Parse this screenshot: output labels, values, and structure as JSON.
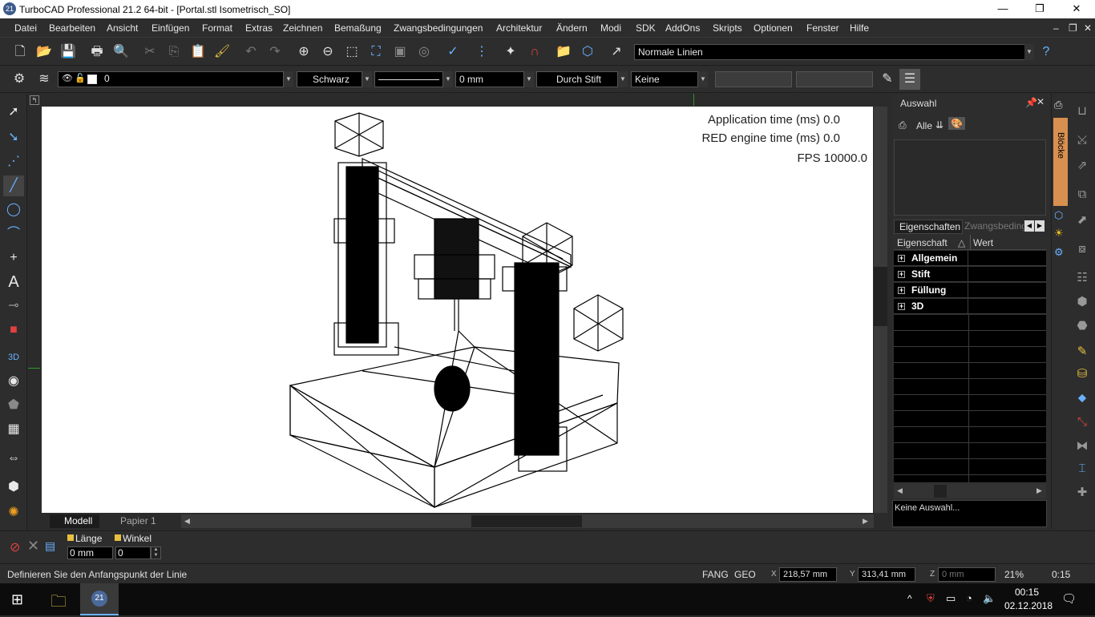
{
  "window": {
    "title": "TurboCAD Professional 21.2 64-bit - [Portal.stl Isometrisch_SO]",
    "app_icon": "21"
  },
  "menu": [
    "Datei",
    "Bearbeiten",
    "Ansicht",
    "Einfügen",
    "Format",
    "Extras",
    "Zeichnen",
    "Bemaßung",
    "Zwangsbedingungen",
    "Architektur",
    "Ändern",
    "Modi",
    "SDK",
    "AddOns",
    "Skripts",
    "Optionen",
    "Fenster",
    "Hilfe"
  ],
  "toolbar1": {
    "line_style": "Normale Linien"
  },
  "toolbar2": {
    "layer": "0",
    "color": "Schwarz",
    "width": "0 mm",
    "fill": "Durch Stift",
    "pattern": "Keine"
  },
  "overlay": {
    "app_time": "Application time (ms)  0.0",
    "red_time": "RED engine time (ms)  0.0",
    "fps": "FPS  10000.0"
  },
  "tabs": {
    "model": "Modell",
    "paper": "Papier 1"
  },
  "selection_panel": {
    "title": "Auswahl",
    "all_label": "Alle",
    "blocks_tab": "Blöcke"
  },
  "props": {
    "tab_props": "Eigenschaften",
    "tab_constraints": "Zwangsbeding",
    "col_prop": "Eigenschaft",
    "col_value": "Wert",
    "groups": [
      "Allgemein",
      "Stift",
      "Füllung",
      "3D"
    ],
    "info": "Keine Auswahl..."
  },
  "input": {
    "length_label": "Länge",
    "length_value": "0 mm",
    "angle_label": "Winkel",
    "angle_value": "0"
  },
  "status": {
    "prompt": "Definieren Sie den Anfangspunkt der Linie",
    "snap": "FANG",
    "geo": "GEO",
    "x": "218,57 mm",
    "y": "313,41 mm",
    "z": "0 mm",
    "zoom": "21%",
    "time": "0:15"
  },
  "taskbar": {
    "clock": "00:15",
    "date": "02.12.2018"
  }
}
